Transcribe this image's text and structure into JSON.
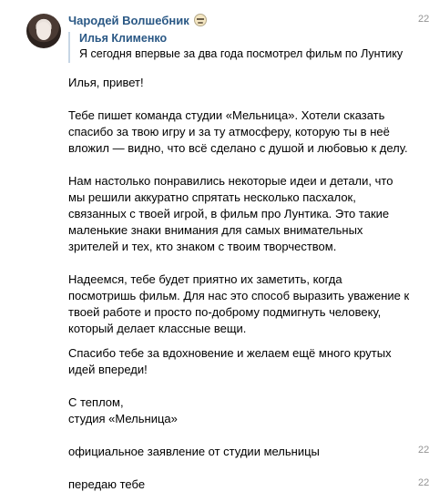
{
  "sender": {
    "name": "Чародей Волшебник",
    "avatar_icon": "user-avatar",
    "badge_icon": "emoji-smirk-icon",
    "time": "22"
  },
  "reply": {
    "author": "Илья Клименко",
    "text": "Я сегодня впервые за два года посмотрел фильм по Лунтику"
  },
  "main_message": {
    "p1": "Илья, привет!",
    "p2": "Тебе пишет команда студии «Мельница». Хотели сказать спасибо за твою игру и за ту атмосферу, которую ты в неё вложил — видно, что всё сделано с душой и любовью к делу.",
    "p3": "Нам настолько понравились некоторые идеи и детали, что мы решили аккуратно спрятать несколько пасхалок, связанных с твоей игрой, в фильм про Лунтика. Это такие маленькие знаки внимания для самых внимательных зрителей и тех, кто знаком с твоим творчеством.",
    "p4": "Надеемся, тебе будет приятно их заметить, когда посмотришь фильм. Для нас это способ выразить уважение к твоей работе и просто по-доброму подмигнуть человеку, который делает классные вещи.",
    "p5": "Спасибо тебе за вдохновение и желаем ещё много крутых идей впереди!",
    "p6": "С теплом,\nстудия «Мельница»"
  },
  "followups": [
    {
      "text": "официальное заявление от студии мельницы",
      "time": "22"
    },
    {
      "text": "передаю тебе",
      "time": "22"
    }
  ],
  "colors": {
    "link": "#2a5885",
    "quote_bar": "#c7d6e5",
    "time": "#939393"
  }
}
